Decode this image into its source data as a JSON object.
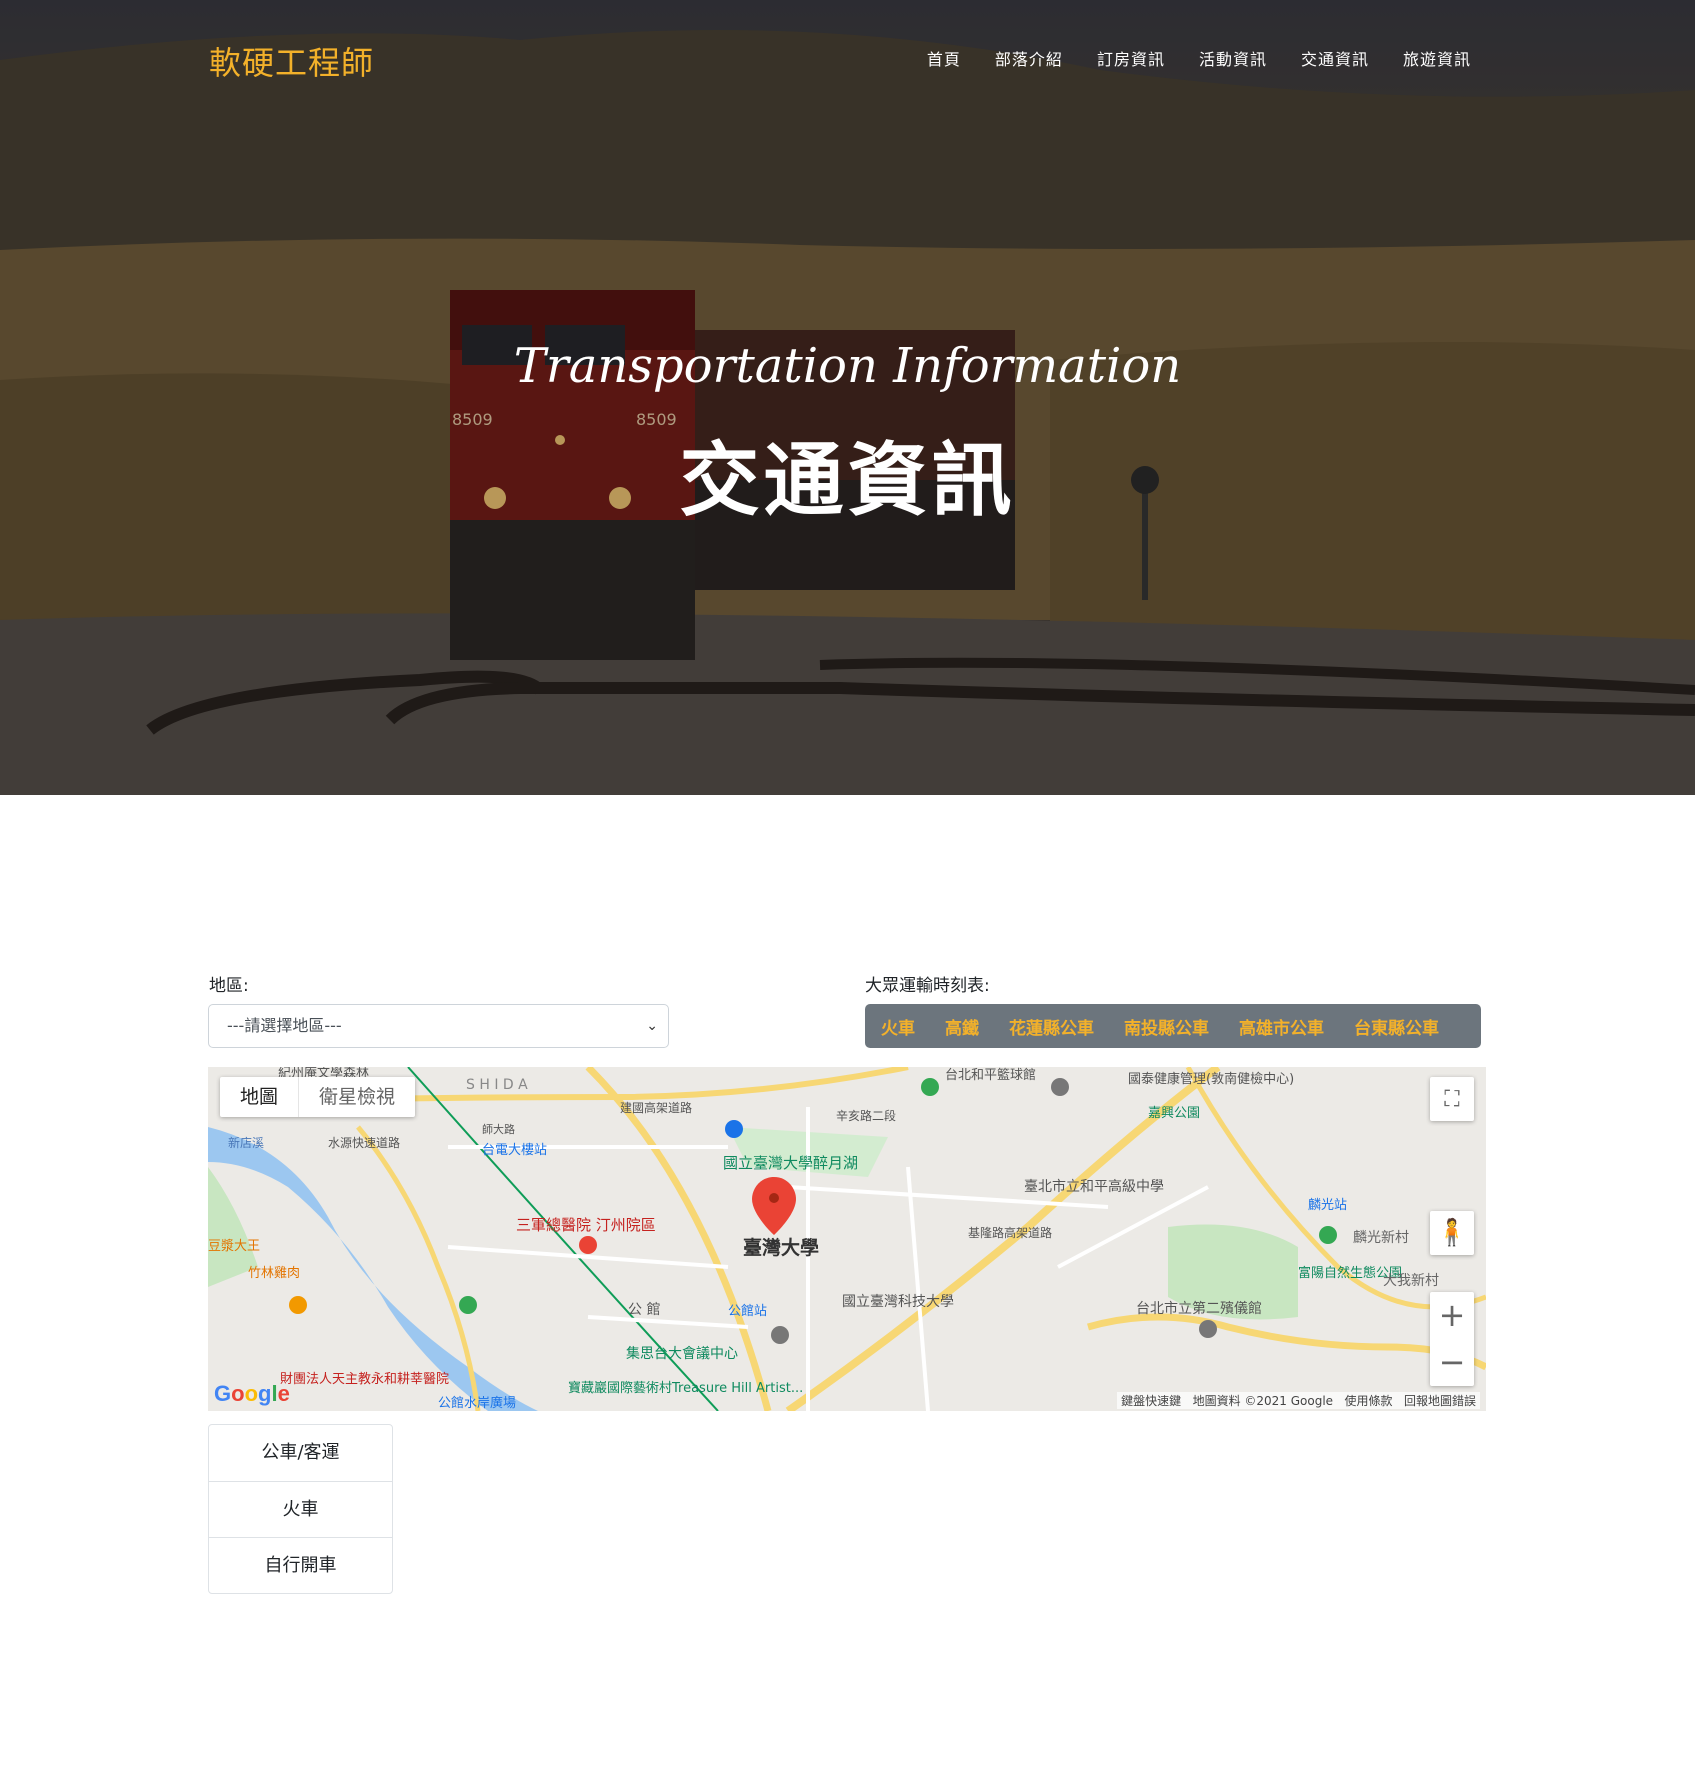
{
  "header": {
    "brand": "軟硬工程師",
    "nav": [
      "首頁",
      "部落介紹",
      "訂房資訊",
      "活動資訊",
      "交通資訊",
      "旅遊資訊"
    ]
  },
  "hero": {
    "subtitle": "Transportation Information",
    "title": "交通資訊",
    "train_number": "8509"
  },
  "filters": {
    "region_label": "地區:",
    "region_select_value": "---請選擇地區---",
    "schedule_label": "大眾運輸時刻表:",
    "schedule_links": [
      "火車",
      "高鐵",
      "花蓮縣公車",
      "南投縣公車",
      "高雄市公車",
      "台東縣公車"
    ]
  },
  "map": {
    "type_options": [
      "地圖",
      "衛星檢視"
    ],
    "marker_label": "臺灣大學",
    "places": [
      "國立臺灣大學醉月湖",
      "三軍總醫院 汀州院區",
      "台電大樓站",
      "公館站",
      "公 館",
      "國立臺灣科技大學",
      "臺北市立和平高級中學",
      "台北市立第二殯儀館",
      "富陽自然生態公園",
      "麟光站",
      "國泰健康管理(敦南健檢中心)",
      "嘉興公園",
      "台北和平籃球館",
      "集思台大會議中心",
      "寶藏巖國際藝術村Treasure Hill Artist...",
      "竹林雞肉",
      "財團法人天主教永和耕莘醫院",
      "公館水岸廣場",
      "S H I D A",
      "辛亥路二段",
      "基隆路高架道路",
      "水源快速道路",
      "建國高架道路",
      "新店溪",
      "師大路",
      "紀州庵文學森林",
      "大我新村",
      "麟光新村",
      "豆漿大王"
    ],
    "attribution": [
      "鍵盤快速鍵",
      "地圖資料 ©2021 Google",
      "使用條款",
      "回報地圖錯誤"
    ],
    "logo": "Google",
    "zoom_in": "+",
    "zoom_out": "−"
  },
  "transport_list": [
    "公車/客運",
    "火車",
    "自行開車"
  ],
  "colors": {
    "brand": "#f3b12a",
    "schedule_bg": "#6c757d",
    "map_marker": "#ea4335"
  }
}
